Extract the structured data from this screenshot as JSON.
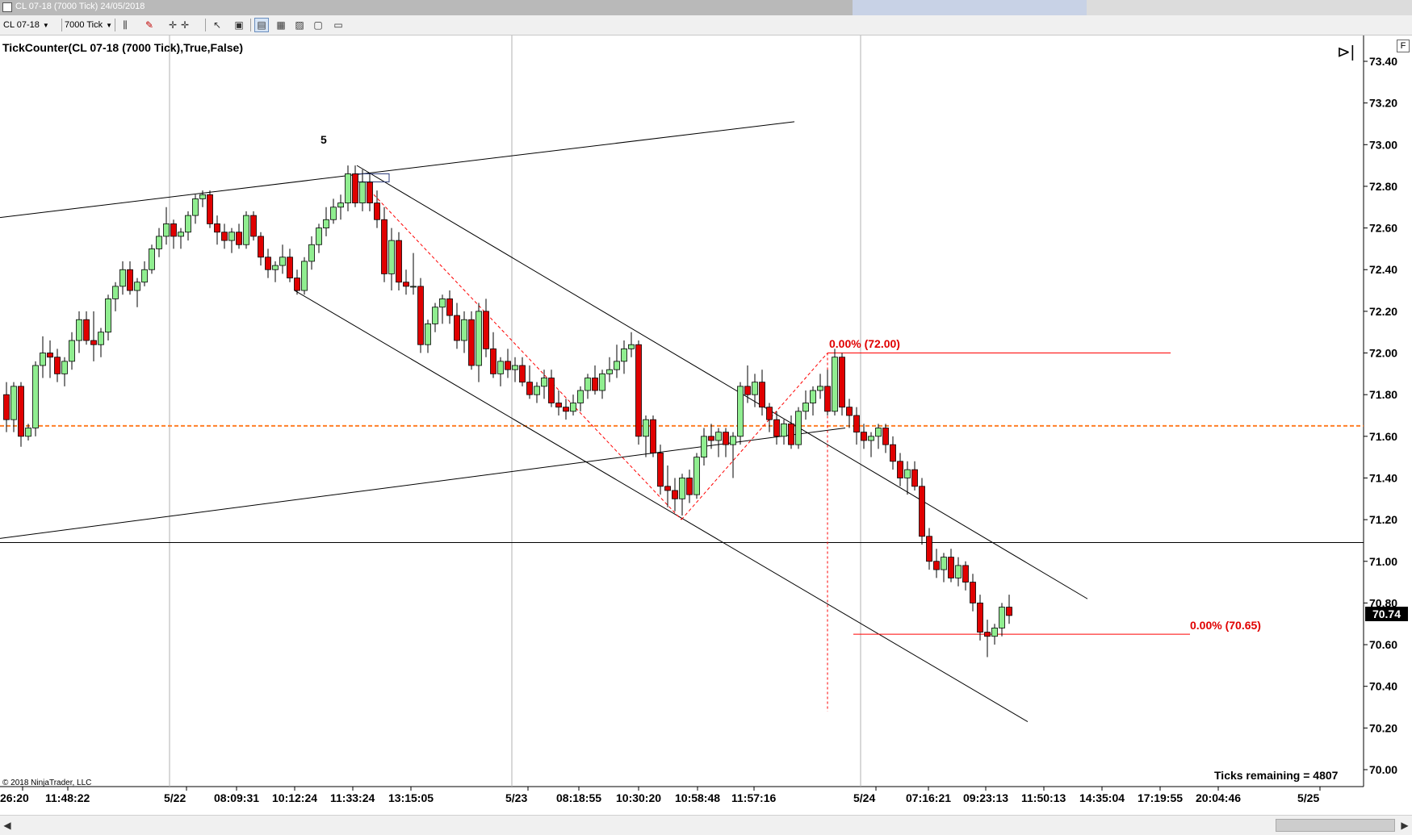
{
  "window": {
    "title": "CL 07-18 (7000 Tick)  24/05/2018"
  },
  "toolbar": {
    "instrument": "CL 07-18",
    "interval": "7000 Tick",
    "icons": [
      "bars-icon",
      "pencil-icon",
      "crosshair-icon",
      "crosshair-plus-icon",
      "pointer-icon",
      "properties-icon",
      "chart-style-icon",
      "data-box-icon",
      "indicators-icon",
      "strategies-icon"
    ]
  },
  "chart": {
    "indicator_label": "TickCounter(CL 07-18 (7000 Tick),True,False)",
    "wave_label": "5",
    "fib_upper_label": "0.00% (72.00)",
    "fib_lower_label": "0.00% (70.65)",
    "copyright": "© 2018 NinjaTrader, LLC",
    "ticks_remaining": "Ticks remaining = 4807",
    "current_price": "70.74",
    "panel_button": "F",
    "colors": {
      "up": "#90ee90",
      "down": "#e00000",
      "wick": "#000000",
      "fib": "#ff0000",
      "dashed": "#ff7f27"
    }
  },
  "chart_data": {
    "type": "candlestick",
    "instrument": "CL 07-18",
    "interval": "7000 Tick",
    "y_ticks": [
      "73.40",
      "73.20",
      "73.00",
      "72.80",
      "72.60",
      "72.40",
      "72.20",
      "72.00",
      "71.80",
      "71.60",
      "71.40",
      "71.20",
      "71.00",
      "70.80",
      "70.60",
      "70.40",
      "70.20",
      "70.00"
    ],
    "ylim": [
      69.91,
      73.51
    ],
    "x_labels": [
      "26:20",
      "11:48:22",
      "5/22",
      "08:09:31",
      "10:12:24",
      "11:33:24",
      "13:15:05",
      "5/23",
      "08:18:55",
      "10:30:20",
      "10:58:48",
      "11:57:16",
      "5/24",
      "07:16:21",
      "09:23:13",
      "11:50:13",
      "14:35:04",
      "17:19:55",
      "20:04:46",
      "5/25"
    ],
    "candles": [
      [
        71.8,
        71.86,
        71.62,
        71.68
      ],
      [
        71.68,
        71.86,
        71.62,
        71.84
      ],
      [
        71.84,
        71.86,
        71.55,
        71.6
      ],
      [
        71.6,
        71.66,
        71.58,
        71.64
      ],
      [
        71.64,
        71.96,
        71.6,
        71.94
      ],
      [
        71.94,
        72.08,
        71.88,
        72.0
      ],
      [
        72.0,
        72.06,
        71.88,
        71.98
      ],
      [
        71.98,
        72.02,
        71.86,
        71.9
      ],
      [
        71.9,
        71.98,
        71.84,
        71.96
      ],
      [
        71.96,
        72.1,
        71.92,
        72.06
      ],
      [
        72.06,
        72.2,
        72.0,
        72.16
      ],
      [
        72.16,
        72.2,
        72.04,
        72.06
      ],
      [
        72.06,
        72.2,
        71.96,
        72.04
      ],
      [
        72.04,
        72.12,
        71.98,
        72.1
      ],
      [
        72.1,
        72.28,
        72.06,
        72.26
      ],
      [
        72.26,
        72.34,
        72.2,
        72.32
      ],
      [
        72.32,
        72.44,
        72.28,
        72.4
      ],
      [
        72.4,
        72.44,
        72.28,
        72.3
      ],
      [
        72.3,
        72.36,
        72.22,
        72.34
      ],
      [
        72.34,
        72.44,
        72.32,
        72.4
      ],
      [
        72.4,
        72.52,
        72.38,
        72.5
      ],
      [
        72.5,
        72.6,
        72.46,
        72.56
      ],
      [
        72.56,
        72.7,
        72.52,
        72.62
      ],
      [
        72.62,
        72.64,
        72.5,
        72.56
      ],
      [
        72.56,
        72.6,
        72.5,
        72.58
      ],
      [
        72.58,
        72.68,
        72.54,
        72.66
      ],
      [
        72.66,
        72.76,
        72.62,
        72.74
      ],
      [
        72.74,
        72.78,
        72.7,
        72.76
      ],
      [
        72.76,
        72.78,
        72.6,
        72.62
      ],
      [
        72.62,
        72.66,
        72.52,
        72.58
      ],
      [
        72.58,
        72.62,
        72.5,
        72.54
      ],
      [
        72.54,
        72.6,
        72.48,
        72.58
      ],
      [
        72.58,
        72.62,
        72.5,
        72.52
      ],
      [
        72.52,
        72.68,
        72.5,
        72.66
      ],
      [
        72.66,
        72.68,
        72.54,
        72.56
      ],
      [
        72.56,
        72.58,
        72.42,
        72.46
      ],
      [
        72.46,
        72.5,
        72.36,
        72.4
      ],
      [
        72.4,
        72.44,
        72.34,
        72.42
      ],
      [
        72.42,
        72.52,
        72.38,
        72.46
      ],
      [
        72.46,
        72.5,
        72.34,
        72.36
      ],
      [
        72.36,
        72.4,
        72.28,
        72.3
      ],
      [
        72.3,
        72.46,
        72.28,
        72.44
      ],
      [
        72.44,
        72.56,
        72.4,
        72.52
      ],
      [
        72.52,
        72.62,
        72.48,
        72.6
      ],
      [
        72.6,
        72.7,
        72.56,
        72.64
      ],
      [
        72.64,
        72.74,
        72.62,
        72.7
      ],
      [
        72.7,
        72.76,
        72.64,
        72.72
      ],
      [
        72.72,
        72.9,
        72.68,
        72.86
      ],
      [
        72.86,
        72.9,
        72.7,
        72.72
      ],
      [
        72.72,
        72.88,
        72.68,
        72.82
      ],
      [
        72.82,
        72.86,
        72.68,
        72.72
      ],
      [
        72.72,
        72.78,
        72.6,
        72.64
      ],
      [
        72.64,
        72.7,
        72.34,
        72.38
      ],
      [
        72.38,
        72.6,
        72.3,
        72.54
      ],
      [
        72.54,
        72.58,
        72.3,
        72.34
      ],
      [
        72.34,
        72.4,
        72.28,
        72.32
      ],
      [
        72.32,
        72.48,
        72.28,
        72.32
      ],
      [
        72.32,
        72.36,
        72.0,
        72.04
      ],
      [
        72.04,
        72.16,
        72.0,
        72.14
      ],
      [
        72.14,
        72.24,
        72.1,
        72.22
      ],
      [
        72.22,
        72.28,
        72.14,
        72.26
      ],
      [
        72.26,
        72.3,
        72.14,
        72.18
      ],
      [
        72.18,
        72.24,
        72.02,
        72.06
      ],
      [
        72.06,
        72.2,
        72.0,
        72.16
      ],
      [
        72.16,
        72.2,
        71.92,
        71.94
      ],
      [
        71.94,
        72.24,
        71.86,
        72.2
      ],
      [
        72.2,
        72.26,
        71.98,
        72.02
      ],
      [
        72.02,
        72.1,
        71.88,
        71.9
      ],
      [
        71.9,
        71.98,
        71.84,
        71.96
      ],
      [
        71.96,
        72.02,
        71.88,
        71.92
      ],
      [
        71.92,
        71.98,
        71.86,
        71.94
      ],
      [
        71.94,
        71.98,
        71.84,
        71.86
      ],
      [
        71.86,
        71.94,
        71.78,
        71.8
      ],
      [
        71.8,
        71.86,
        71.76,
        71.84
      ],
      [
        71.84,
        71.92,
        71.78,
        71.88
      ],
      [
        71.88,
        71.92,
        71.74,
        71.76
      ],
      [
        71.76,
        71.82,
        71.7,
        71.74
      ],
      [
        71.74,
        71.78,
        71.68,
        71.72
      ],
      [
        71.72,
        71.8,
        71.7,
        71.76
      ],
      [
        71.76,
        71.84,
        71.72,
        71.82
      ],
      [
        71.82,
        71.9,
        71.78,
        71.88
      ],
      [
        71.88,
        71.94,
        71.8,
        71.82
      ],
      [
        71.82,
        71.92,
        71.78,
        71.9
      ],
      [
        71.9,
        71.98,
        71.86,
        71.92
      ],
      [
        71.92,
        72.04,
        71.88,
        71.96
      ],
      [
        71.96,
        72.06,
        71.9,
        72.02
      ],
      [
        72.02,
        72.1,
        71.98,
        72.04
      ],
      [
        72.04,
        72.06,
        71.56,
        71.6
      ],
      [
        71.6,
        71.7,
        71.5,
        71.68
      ],
      [
        71.68,
        71.7,
        71.5,
        71.52
      ],
      [
        71.52,
        71.56,
        71.32,
        71.36
      ],
      [
        71.36,
        71.46,
        71.26,
        71.34
      ],
      [
        71.34,
        71.4,
        71.24,
        71.3
      ],
      [
        71.3,
        71.42,
        71.22,
        71.4
      ],
      [
        71.4,
        71.44,
        71.28,
        71.32
      ],
      [
        71.32,
        71.52,
        71.3,
        71.5
      ],
      [
        71.5,
        71.64,
        71.46,
        71.6
      ],
      [
        71.6,
        71.66,
        71.54,
        71.58
      ],
      [
        71.58,
        71.64,
        71.5,
        71.62
      ],
      [
        71.62,
        71.64,
        71.5,
        71.56
      ],
      [
        71.56,
        71.62,
        71.4,
        71.6
      ],
      [
        71.6,
        71.86,
        71.56,
        71.84
      ],
      [
        71.84,
        71.94,
        71.76,
        71.8
      ],
      [
        71.8,
        71.9,
        71.74,
        71.86
      ],
      [
        71.86,
        71.92,
        71.7,
        71.74
      ],
      [
        71.74,
        71.76,
        71.62,
        71.68
      ],
      [
        71.68,
        71.72,
        71.56,
        71.6
      ],
      [
        71.6,
        71.68,
        71.56,
        71.66
      ],
      [
        71.66,
        71.7,
        71.54,
        71.56
      ],
      [
        71.56,
        71.74,
        71.54,
        71.72
      ],
      [
        71.72,
        71.82,
        71.68,
        71.76
      ],
      [
        71.76,
        71.84,
        71.7,
        71.82
      ],
      [
        71.82,
        71.9,
        71.78,
        71.84
      ],
      [
        71.84,
        71.92,
        71.7,
        71.72
      ],
      [
        71.72,
        72.02,
        71.7,
        71.98
      ],
      [
        71.98,
        72.0,
        71.7,
        71.74
      ],
      [
        71.74,
        71.78,
        71.64,
        71.7
      ],
      [
        71.7,
        71.74,
        71.56,
        71.62
      ],
      [
        71.62,
        71.66,
        71.54,
        71.58
      ],
      [
        71.58,
        71.62,
        71.5,
        71.6
      ],
      [
        71.6,
        71.66,
        71.54,
        71.64
      ],
      [
        71.64,
        71.66,
        71.52,
        71.56
      ],
      [
        71.56,
        71.6,
        71.44,
        71.48
      ],
      [
        71.48,
        71.52,
        71.36,
        71.4
      ],
      [
        71.4,
        71.48,
        71.32,
        71.44
      ],
      [
        71.44,
        71.48,
        71.34,
        71.36
      ],
      [
        71.36,
        71.4,
        71.08,
        71.12
      ],
      [
        71.12,
        71.16,
        70.96,
        71.0
      ],
      [
        71.0,
        71.06,
        70.92,
        70.96
      ],
      [
        70.96,
        71.04,
        70.9,
        71.02
      ],
      [
        71.02,
        71.06,
        70.9,
        70.92
      ],
      [
        70.92,
        71.02,
        70.88,
        70.98
      ],
      [
        70.98,
        71.0,
        70.86,
        70.9
      ],
      [
        70.9,
        70.94,
        70.76,
        70.8
      ],
      [
        70.8,
        70.84,
        70.62,
        70.66
      ],
      [
        70.66,
        70.72,
        70.54,
        70.64
      ],
      [
        70.64,
        70.7,
        70.6,
        70.68
      ],
      [
        70.68,
        70.8,
        70.64,
        70.78
      ],
      [
        70.78,
        70.84,
        70.7,
        70.74
      ]
    ],
    "drawings": {
      "horizontal_line": 71.09,
      "dashed_level": 71.65,
      "fib_upper": 72.0,
      "fib_lower": 70.65
    },
    "current_price": 70.74,
    "title": "TickCounter(CL 07-18 (7000 Tick),True,False)"
  }
}
